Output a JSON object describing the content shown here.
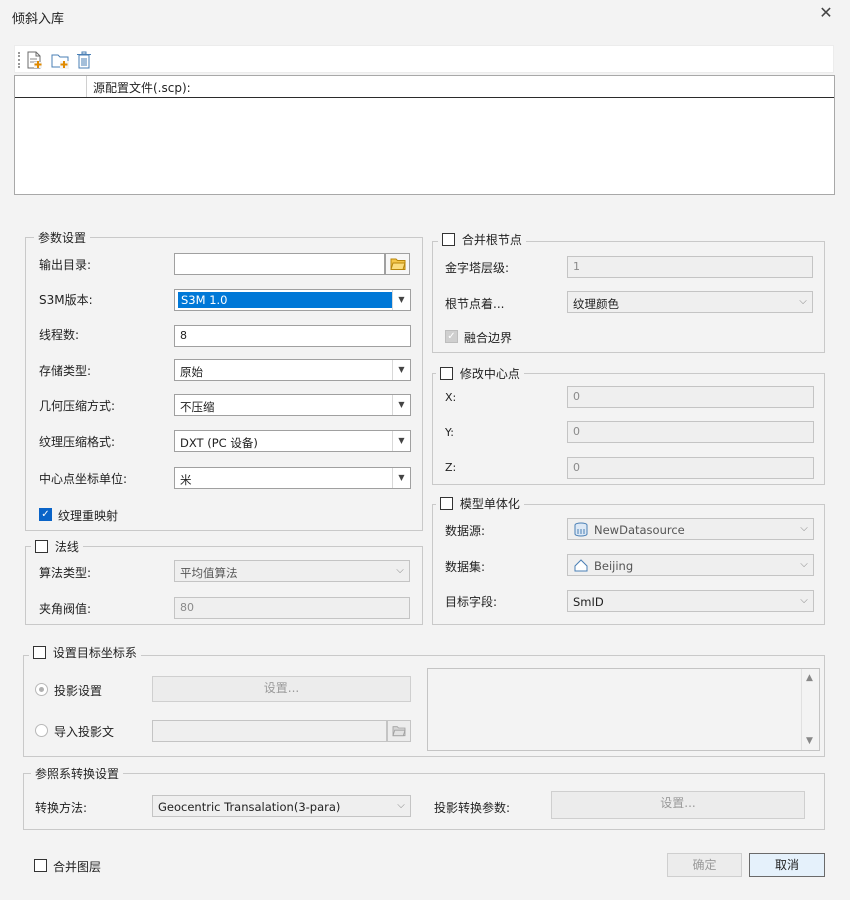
{
  "window": {
    "title": "倾斜入库",
    "close_glyph": "✕"
  },
  "toolbar": {
    "icons": [
      "add-file-icon",
      "add-folder-icon",
      "delete-icon"
    ]
  },
  "list": {
    "header": "源配置文件(.scp):"
  },
  "params": {
    "legend": "参数设置",
    "output_dir_label": "输出目录:",
    "output_dir_value": "",
    "s3m_label": "S3M版本:",
    "s3m_value": "S3M 1.0",
    "threads_label": "线程数:",
    "threads_value": "8",
    "storage_label": "存储类型:",
    "storage_value": "原始",
    "geom_label": "几何压缩方式:",
    "geom_value": "不压缩",
    "texture_label": "纹理压缩格式:",
    "texture_value": "DXT (PC 设备)",
    "unit_label": "中心点坐标单位:",
    "unit_value": "米",
    "remap_label": "纹理重映射",
    "remap_checked": true
  },
  "normal": {
    "legend": "法线",
    "algo_label": "算法类型:",
    "algo_value": "平均值算法",
    "angle_label": "夹角阀值:",
    "angle_value": "80"
  },
  "merge_root": {
    "legend": "合并根节点",
    "pyramid_label": "金字塔层级:",
    "pyramid_value": "1",
    "root_label": "根节点着...",
    "root_value": "纹理颜色",
    "blend_label": "融合边界"
  },
  "center": {
    "legend": "修改中心点",
    "x_label": "X:",
    "x_value": "0",
    "y_label": "Y:",
    "y_value": "0",
    "z_label": "Z:",
    "z_value": "0"
  },
  "model": {
    "legend": "模型单体化",
    "datasource_label": "数据源:",
    "datasource_value": "NewDatasource",
    "dataset_label": "数据集:",
    "dataset_value": "Beijing",
    "field_label": "目标字段:",
    "field_value": "SmID"
  },
  "target_crs": {
    "legend": "设置目标坐标系",
    "proj_label": "投影设置",
    "proj_button": "设置...",
    "import_label": "导入投影文"
  },
  "transform": {
    "legend": "参照系转换设置",
    "method_label": "转换方法:",
    "method_value": "Geocentric Transalation(3-para)",
    "param_label": "投影转换参数:",
    "param_button": "设置..."
  },
  "footer": {
    "merge_layers_label": "合并图层",
    "ok_label": "确定",
    "cancel_label": "取消"
  },
  "colors": {
    "accent": "#0078d7",
    "checkbox": "#0a64c8",
    "background": "#f3f3f3"
  }
}
